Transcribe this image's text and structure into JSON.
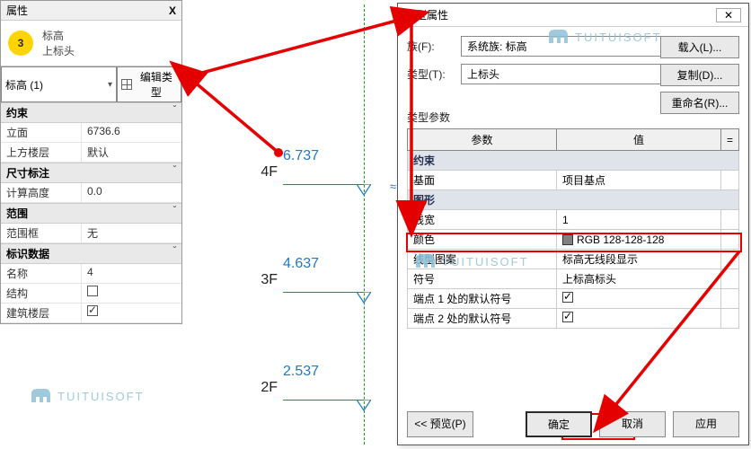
{
  "props_panel": {
    "title": "属性",
    "close": "X",
    "badge": "3",
    "head_line1": "标高",
    "head_line2": "上标头",
    "type_select": "标高 (1)",
    "edit_type": "编辑类型",
    "groups": {
      "constraint": "约束",
      "dimension": "尺寸标注",
      "scope": "范围",
      "identity": "标识数据"
    },
    "rows": {
      "elevation_label": "立面",
      "elevation_value": "6736.6",
      "above_label": "上方楼层",
      "above_value": "默认",
      "calc_label": "计算高度",
      "calc_value": "0.0",
      "scope_label": "范围框",
      "scope_value": "无",
      "name_label": "名称",
      "name_value": "4",
      "struct_label": "结构",
      "floor_label": "建筑楼层"
    },
    "expander": "ˇ"
  },
  "canvas": {
    "levels": [
      {
        "name": "4F",
        "value": "6.737"
      },
      {
        "name": "3F",
        "value": "4.637"
      },
      {
        "name": "2F",
        "value": "2.537"
      }
    ]
  },
  "dialog": {
    "title": "类型属性",
    "close": "✕",
    "family_label": "族(F):",
    "family_value": "系统族: 标高",
    "type_label": "类型(T):",
    "type_value": "上标头",
    "load_btn": "载入(L)...",
    "copy_btn": "复制(D)...",
    "rename_btn": "重命名(R)...",
    "params_label": "类型参数",
    "col_param": "参数",
    "col_value": "值",
    "col_eq": "=",
    "group_constraint": "约束",
    "row_base_label": "基面",
    "row_base_value": "项目基点",
    "group_graphics": "图形",
    "row_lw_label": "线宽",
    "row_lw_value": "1",
    "row_color_label": "颜色",
    "row_color_value": "RGB 128-128-128",
    "row_pattern_label": "线型图案",
    "row_pattern_value": "标高无线段显示",
    "row_symbol_label": "符号",
    "row_symbol_value": "上标高标头",
    "row_end1_label": "端点 1 处的默认符号",
    "row_end2_label": "端点 2 处的默认符号",
    "preview_btn": "<< 预览(P)",
    "ok_btn": "确定",
    "cancel_btn": "取消",
    "apply_btn": "应用"
  },
  "watermark": "TUITUISOFT"
}
